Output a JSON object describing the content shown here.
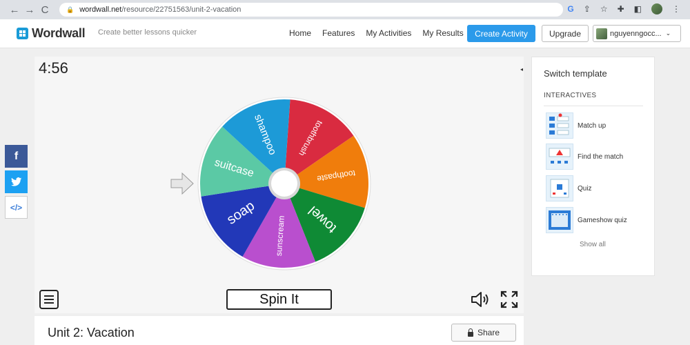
{
  "browser": {
    "url_host": "wordwall.net",
    "url_path": "/resource/22751563/unit-2-vacation"
  },
  "header": {
    "logo": "Wordwall",
    "tagline": "Create better lessons quicker",
    "nav": [
      "Home",
      "Features",
      "My Activities",
      "My Results"
    ],
    "create_label": "Create Activity",
    "upgrade_label": "Upgrade",
    "username": "nguyenngocc..."
  },
  "social": {
    "facebook": "f",
    "embed": "</>"
  },
  "game": {
    "timer": "4:56",
    "spin_label": "Spin It",
    "wheel": [
      {
        "label": "toothbrush",
        "color": "#d92b40"
      },
      {
        "label": "toothpaste",
        "color": "#f07d0c"
      },
      {
        "label": "towel",
        "color": "#0f8a35"
      },
      {
        "label": "sunscream",
        "color": "#b94fce"
      },
      {
        "label": "soap",
        "color": "#2238b8"
      },
      {
        "label": "suitcase",
        "color": "#5bc9a5"
      },
      {
        "label": "shampoo",
        "color": "#1d9ad7"
      }
    ]
  },
  "activity": {
    "title": "Unit 2: Vacation",
    "share_label": "Share"
  },
  "sidebar": {
    "title": "Switch template",
    "section": "INTERACTIVES",
    "templates": [
      {
        "label": "Match up"
      },
      {
        "label": "Find the match"
      },
      {
        "label": "Quiz"
      },
      {
        "label": "Gameshow quiz"
      }
    ],
    "show_all": "Show all"
  }
}
